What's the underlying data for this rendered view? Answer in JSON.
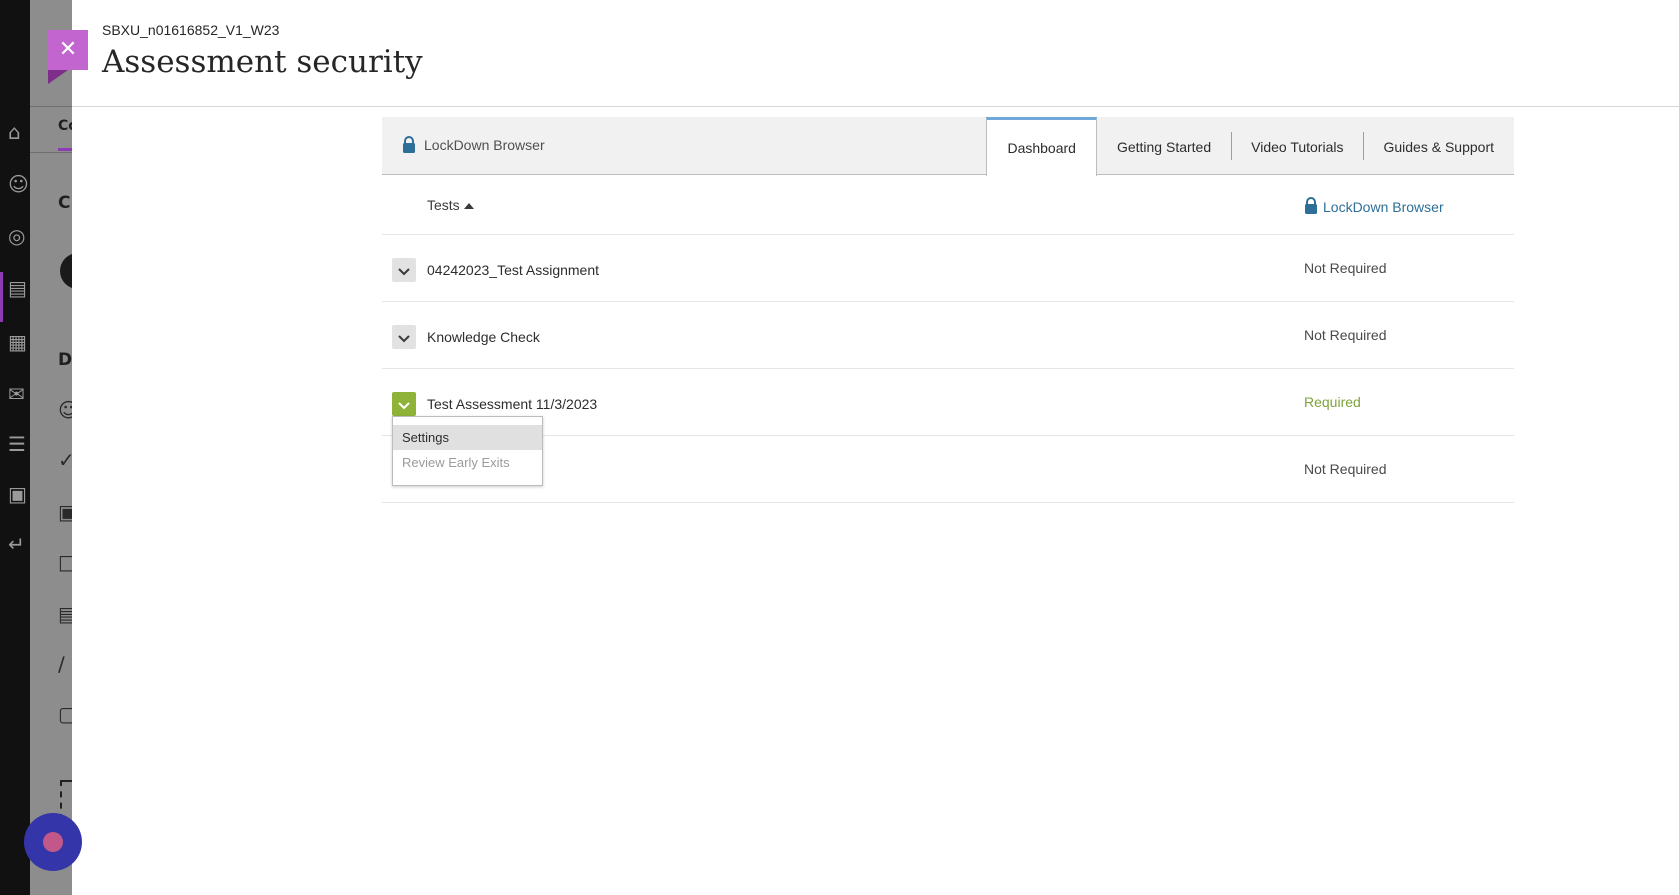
{
  "header": {
    "course_id": "SBXU_n01616852_V1_W23",
    "title": "Assessment security",
    "close_icon": "close-icon"
  },
  "ldb": {
    "brand_label": "LockDown Browser",
    "tabs": [
      {
        "label": "Dashboard",
        "active": true
      },
      {
        "label": "Getting Started",
        "active": false
      },
      {
        "label": "Video Tutorials",
        "active": false
      },
      {
        "label": "Guides & Support",
        "active": false
      }
    ],
    "columns": {
      "tests": "Tests",
      "lockdown": "LockDown Browser"
    },
    "rows": [
      {
        "name": "04242023_Test Assignment",
        "status": "Not Required"
      },
      {
        "name": "Knowledge Check",
        "status": "Not Required"
      },
      {
        "name": "Test Assessment 11/3/2023",
        "status": "Required"
      },
      {
        "name": "",
        "status": "Not Required"
      }
    ],
    "menu": {
      "items": [
        {
          "label": "Settings"
        },
        {
          "label": "Review Early Exits"
        }
      ]
    }
  },
  "background": {
    "letters": [
      "Co",
      "C",
      "D"
    ]
  },
  "colors": {
    "accent_purple": "#c265cf",
    "required_green": "#7ea33a",
    "link_blue": "#2d6f98",
    "active_tab_top": "#6fa8d8"
  }
}
